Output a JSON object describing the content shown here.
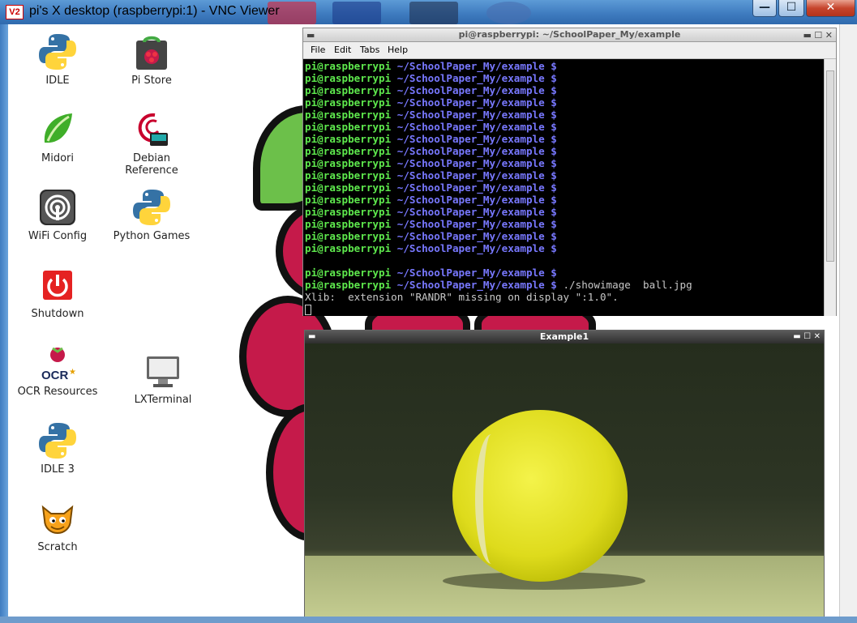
{
  "window": {
    "logo": "V2",
    "title": "pi's X desktop (raspberrypi:1) - VNC Viewer",
    "minimize_glyph": "—",
    "maximize_glyph": "☐",
    "close_glyph": "✕"
  },
  "desktop_icons": [
    {
      "label": "IDLE",
      "icon": "python-icon"
    },
    {
      "label": "Pi Store",
      "icon": "pi-store-icon"
    },
    {
      "label": "Midori",
      "icon": "midori-icon"
    },
    {
      "label": "Debian\nReference",
      "icon": "debian-icon"
    },
    {
      "label": "WiFi Config",
      "icon": "wifi-icon"
    },
    {
      "label": "Python Games",
      "icon": "python-icon"
    },
    {
      "label": "Shutdown",
      "icon": "power-icon"
    },
    {
      "label": "OCR Resources",
      "icon": "ocr-icon"
    },
    {
      "label": "LXTerminal",
      "icon": "monitor-icon"
    },
    {
      "label": "IDLE 3",
      "icon": "python-icon"
    },
    {
      "label": "Scratch",
      "icon": "scratch-cat-icon"
    }
  ],
  "terminal": {
    "title": "pi@raspberrypi: ~/SchoolPaper_My/example",
    "menu": [
      "File",
      "Edit",
      "Tabs",
      "Help"
    ],
    "user_host": "pi@raspberrypi",
    "path_prompt": " ~/SchoolPaper_My/example $",
    "command": " ./showimage  ball.jpg",
    "error_line": "Xlib:  extension \"RANDR\" missing on display \":1.0\".",
    "prompt_lines_before_blank": 16,
    "prompt_lines_after_blank": 1
  },
  "image_window": {
    "title": "Example1"
  },
  "colors": {
    "prompt_user": "#5ee84d",
    "prompt_path": "#7878ff",
    "raspberry": "#c51a4a",
    "leaf": "#6cc04a",
    "ball": "#dedb1c"
  }
}
